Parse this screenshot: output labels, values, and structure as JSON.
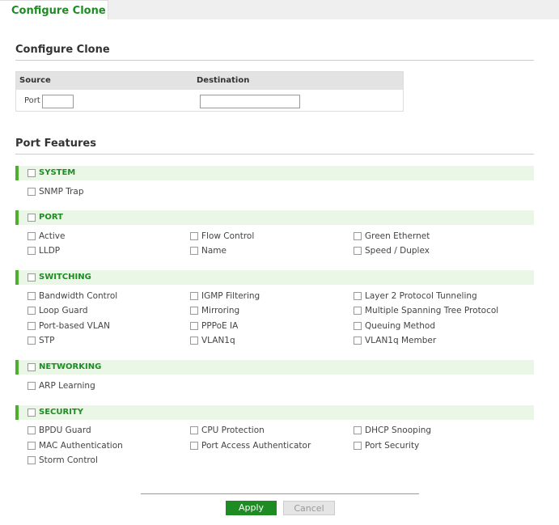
{
  "tab": {
    "label": "Configure Clone"
  },
  "clone": {
    "title": "Configure Clone",
    "source_header": "Source",
    "destination_header": "Destination",
    "port_label": "Port",
    "source_value": "",
    "destination_value": ""
  },
  "features": {
    "title": "Port Features",
    "groups": [
      {
        "label": "SYSTEM",
        "items": [
          "SNMP Trap"
        ]
      },
      {
        "label": "PORT",
        "items": [
          "Active",
          "Flow Control",
          "Green Ethernet",
          "LLDP",
          "Name",
          "Speed / Duplex"
        ]
      },
      {
        "label": "SWITCHING",
        "items": [
          "Bandwidth Control",
          "IGMP Filtering",
          "Layer 2 Protocol Tunneling",
          "Loop Guard",
          "Mirroring",
          "Multiple Spanning Tree Protocol",
          "Port-based VLAN",
          "PPPoE IA",
          "Queuing Method",
          "STP",
          "VLAN1q",
          "VLAN1q Member"
        ]
      },
      {
        "label": "NETWORKING",
        "items": [
          "ARP Learning"
        ]
      },
      {
        "label": "SECURITY",
        "items": [
          "BPDU Guard",
          "CPU Protection",
          "DHCP Snooping",
          "MAC Authentication",
          "Port Access Authenticator",
          "Port Security",
          "Storm Control"
        ]
      }
    ]
  },
  "actions": {
    "apply": "Apply",
    "cancel": "Cancel"
  },
  "colors": {
    "accent": "#1e8c23",
    "group_bar": "#4cb02c",
    "group_bg": "#eaf6e6"
  }
}
